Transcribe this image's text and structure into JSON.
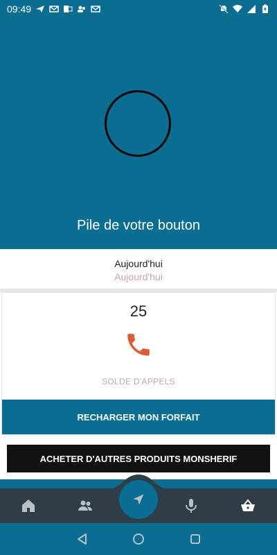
{
  "status_bar": {
    "time": "09:49",
    "left_icons": [
      "send-icon",
      "gmail-icon",
      "outlook-icon",
      "people-app-icon",
      "gmail-icon"
    ],
    "right_icons": [
      "notifications-muted-icon",
      "wifi-icon",
      "signal-icon",
      "battery-icon"
    ]
  },
  "hero": {
    "title": "Pile de votre bouton"
  },
  "date": {
    "primary": "Aujourd'hui",
    "secondary": "Aujourd'hui"
  },
  "card": {
    "count": "25",
    "balance_label": "SOLDE D'APPELS",
    "recharge_label": "RECHARGER MON FORFAIT"
  },
  "buy_button_label": "ACHETER D'AUTRES PRODUITS MONSHERIF",
  "bottom_nav": {
    "items": [
      "home-icon",
      "people-icon",
      "navigation-icon",
      "microphone-icon",
      "basket-icon"
    ],
    "active": "navigation-icon"
  },
  "system_nav": [
    "back-icon",
    "home-circle-icon",
    "recents-icon"
  ],
  "colors": {
    "primary": "#0a6e93",
    "nav_dark": "#2e3d46",
    "phone_icon": "#e05a33",
    "muted_text": "#c9a2a2",
    "buy_button": "#111111"
  }
}
